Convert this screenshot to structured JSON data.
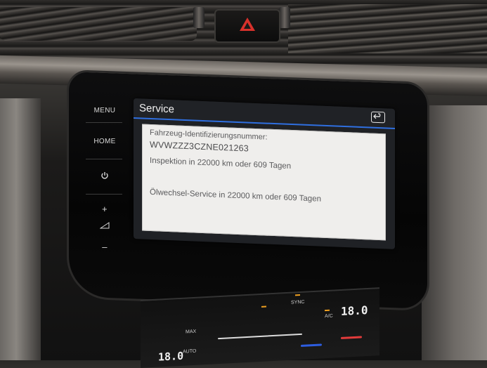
{
  "side_buttons": {
    "menu": "MENU",
    "home": "HOME",
    "power_icon": "power-icon",
    "vol_up": "+",
    "vol_down": "–"
  },
  "screen": {
    "title": "Service",
    "back_icon": "back-icon",
    "accent_color": "#2f6fe0",
    "lines": {
      "vin_label": "Fahrzeug-Identifizierungsnummer:",
      "vin_value": "WVWZZZ3CZNE021263",
      "inspection": "Inspektion in 22000 km oder 609 Tagen",
      "oil_service": "Ölwechsel-Service in 22000 km oder 609 Tagen"
    }
  },
  "climate": {
    "left_temp": "18.0",
    "right_temp": "18.0",
    "sync_label": "SYNC",
    "ac_label": "A/C",
    "auto_label": "AUTO",
    "max_label": "MAX"
  }
}
